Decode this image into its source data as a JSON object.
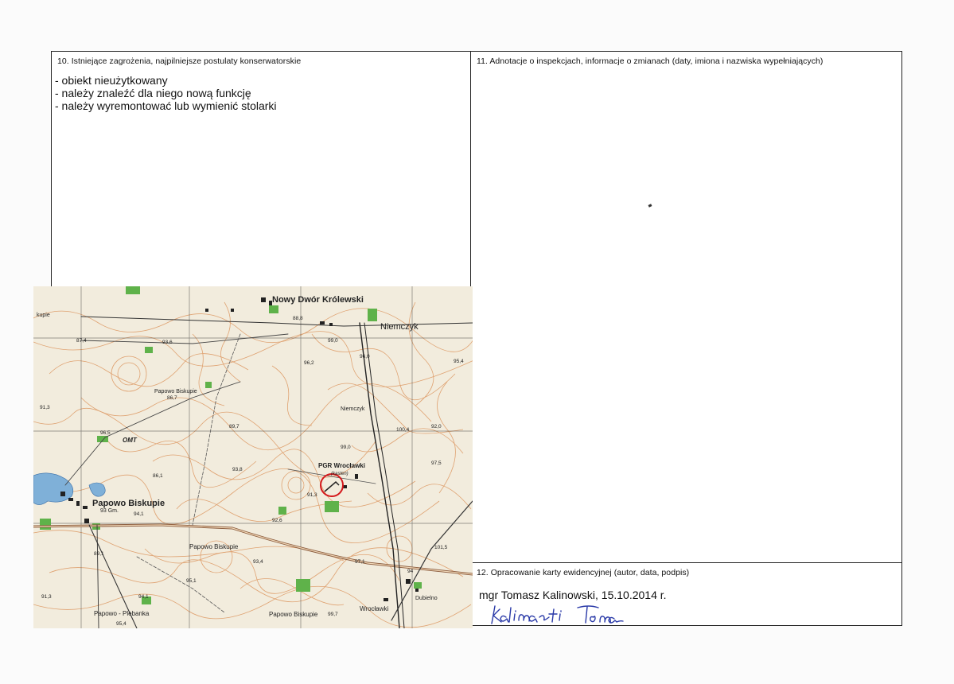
{
  "section10": {
    "heading": "10. Istniejące zagrożenia, najpilniejsze postulaty konserwatorskie",
    "items": [
      "- obiekt nieużytkowany",
      "- należy znaleźć dla niego nową funkcję",
      "- należy wyremontować lub wymienić stolarki"
    ]
  },
  "section11": {
    "heading": "11. Adnotacje o inspekcjach, informacje o zmianach (daty, imiona i nazwiska wypełniających)"
  },
  "section12": {
    "heading": "12. Opracowanie karty ewidencyjnej (autor, data, podpis)",
    "author_line": "mgr Tomasz Kalinowski, 15.10.2014 r.",
    "signature_text": "Kalinowski Tomasz"
  },
  "map": {
    "labels": {
      "nowy_dwor": "Nowy Dwór Królewski",
      "niemczyk": "Niemczyk",
      "niemczyk_small": "Niemczyk",
      "papowo_biskupie_top": "Papowo Biskupie",
      "papowo_biskupie": "Papowo Biskupie",
      "papowo_biskupie_mid": "Papowo Biskupie",
      "papowo_biskupie_bottom": "Papowo Biskupie",
      "papowo_plebanka": "Papowo - Plebanka",
      "pgr_wroclawki": "PGR Wrocławki",
      "kasten": "(kasten)",
      "wroclawki": "Wrocławki",
      "dubielno": "Dubielno",
      "gm": "93 Gm.",
      "kupie": "kupie",
      "omt": "OMT"
    },
    "elevations": [
      "93,6",
      "88,8",
      "99,0",
      "96,0",
      "96,2",
      "95,4",
      "87,4",
      "86,7",
      "91,3",
      "96,5",
      "89,7",
      "100,4",
      "92,0",
      "99,0",
      "97,5",
      "86,1",
      "93,8",
      "91,3",
      "92,6",
      "94,1",
      "101,5",
      "89,1",
      "93,4",
      "95,1",
      "97,1",
      "91,3",
      "94,1",
      "95,4",
      "99,7",
      "94"
    ],
    "colors": {
      "paper": "#f2ecdd",
      "contour": "#d98a4e",
      "road": "#8a5a3c",
      "grid": "#333333",
      "forest": "#5fb24a",
      "water": "#7fb0d8",
      "marker": "#d4171b"
    }
  }
}
